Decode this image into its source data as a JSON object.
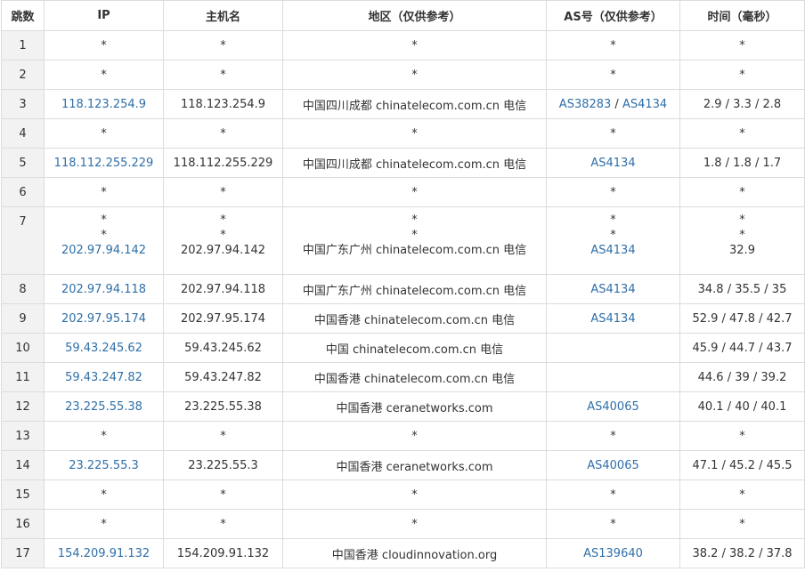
{
  "headers": [
    "跳数",
    "IP",
    "主机名",
    "地区（仅供参考）",
    "AS号（仅供参考）",
    "时间（毫秒）"
  ],
  "rows": [
    {
      "hop": "1",
      "ip": [
        "*"
      ],
      "host": [
        "*"
      ],
      "region": [
        "*"
      ],
      "as": [
        "*"
      ],
      "time": [
        "*"
      ]
    },
    {
      "hop": "2",
      "ip": [
        "*"
      ],
      "host": [
        "*"
      ],
      "region": [
        "*"
      ],
      "as": [
        "*"
      ],
      "time": [
        "*"
      ]
    },
    {
      "hop": "3",
      "ip": [
        "118.123.254.9"
      ],
      "host": [
        "118.123.254.9"
      ],
      "region": [
        "中国四川成都 chinatelecom.com.cn 电信"
      ],
      "as": [
        "AS38283",
        "AS4134"
      ],
      "time": [
        "2.9 / 3.3 / 2.8"
      ]
    },
    {
      "hop": "4",
      "ip": [
        "*"
      ],
      "host": [
        "*"
      ],
      "region": [
        "*"
      ],
      "as": [
        "*"
      ],
      "time": [
        "*"
      ]
    },
    {
      "hop": "5",
      "ip": [
        "118.112.255.229"
      ],
      "host": [
        "118.112.255.229"
      ],
      "region": [
        "中国四川成都 chinatelecom.com.cn 电信"
      ],
      "as": [
        "AS4134"
      ],
      "time": [
        "1.8 / 1.8 / 1.7"
      ]
    },
    {
      "hop": "6",
      "ip": [
        "*"
      ],
      "host": [
        "*"
      ],
      "region": [
        "*"
      ],
      "as": [
        "*"
      ],
      "time": [
        "*"
      ]
    },
    {
      "hop": "7",
      "ip": [
        "*",
        "*",
        "202.97.94.142"
      ],
      "host": [
        "*",
        "*",
        "202.97.94.142"
      ],
      "region": [
        "*",
        "*",
        "中国广东广州 chinatelecom.com.cn 电信"
      ],
      "as": [
        "*",
        "*",
        "AS4134"
      ],
      "time": [
        "*",
        "*",
        "32.9"
      ]
    },
    {
      "hop": "8",
      "ip": [
        "202.97.94.118"
      ],
      "host": [
        "202.97.94.118"
      ],
      "region": [
        "中国广东广州 chinatelecom.com.cn 电信"
      ],
      "as": [
        "AS4134"
      ],
      "time": [
        "34.8 / 35.5 / 35"
      ]
    },
    {
      "hop": "9",
      "ip": [
        "202.97.95.174"
      ],
      "host": [
        "202.97.95.174"
      ],
      "region": [
        "中国香港 chinatelecom.com.cn 电信"
      ],
      "as": [
        "AS4134"
      ],
      "time": [
        "52.9 / 47.8 / 42.7"
      ]
    },
    {
      "hop": "10",
      "ip": [
        "59.43.245.62"
      ],
      "host": [
        "59.43.245.62"
      ],
      "region": [
        "中国 chinatelecom.com.cn 电信"
      ],
      "as": [],
      "time": [
        "45.9 / 44.7 / 43.7"
      ]
    },
    {
      "hop": "11",
      "ip": [
        "59.43.247.82"
      ],
      "host": [
        "59.43.247.82"
      ],
      "region": [
        "中国香港 chinatelecom.com.cn 电信"
      ],
      "as": [],
      "time": [
        "44.6 / 39 / 39.2"
      ]
    },
    {
      "hop": "12",
      "ip": [
        "23.225.55.38"
      ],
      "host": [
        "23.225.55.38"
      ],
      "region": [
        "中国香港 ceranetworks.com"
      ],
      "as": [
        "AS40065"
      ],
      "time": [
        "40.1 / 40 / 40.1"
      ]
    },
    {
      "hop": "13",
      "ip": [
        "*"
      ],
      "host": [
        "*"
      ],
      "region": [
        "*"
      ],
      "as": [
        "*"
      ],
      "time": [
        "*"
      ]
    },
    {
      "hop": "14",
      "ip": [
        "23.225.55.3"
      ],
      "host": [
        "23.225.55.3"
      ],
      "region": [
        "中国香港 ceranetworks.com"
      ],
      "as": [
        "AS40065"
      ],
      "time": [
        "47.1 / 45.2 / 45.5"
      ]
    },
    {
      "hop": "15",
      "ip": [
        "*"
      ],
      "host": [
        "*"
      ],
      "region": [
        "*"
      ],
      "as": [
        "*"
      ],
      "time": [
        "*"
      ]
    },
    {
      "hop": "16",
      "ip": [
        "*"
      ],
      "host": [
        "*"
      ],
      "region": [
        "*"
      ],
      "as": [
        "*"
      ],
      "time": [
        "*"
      ]
    },
    {
      "hop": "17",
      "ip": [
        "154.209.91.132"
      ],
      "host": [
        "154.209.91.132"
      ],
      "region": [
        "中国香港 cloudinnovation.org"
      ],
      "as": [
        "AS139640"
      ],
      "time": [
        "38.2 / 38.2 / 37.8"
      ]
    }
  ],
  "colors": {
    "link": "#2f6fa8",
    "hop_bg": "#f2f2f2",
    "border": "#dcdcdc",
    "text": "#333333"
  }
}
